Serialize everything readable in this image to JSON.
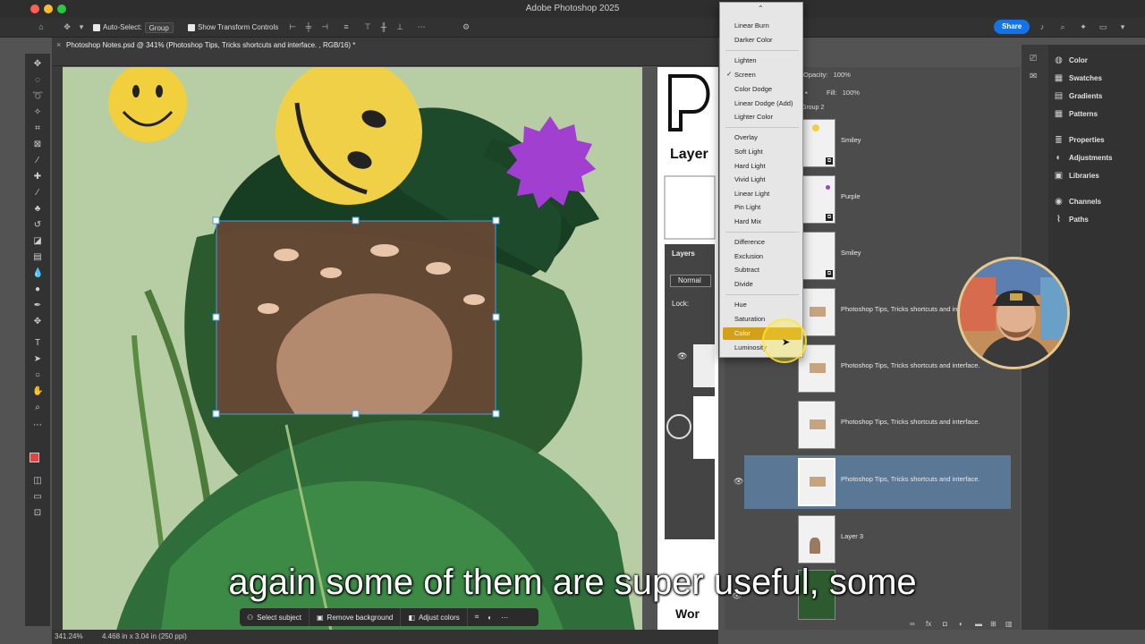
{
  "window": {
    "title": "Adobe Photoshop 2025"
  },
  "options_bar": {
    "auto_select_label": "Auto-Select:",
    "auto_select_value": "Group",
    "show_transform_label": "Show Transform Controls",
    "share_label": "Share"
  },
  "document": {
    "tab_title": "Photoshop Notes.psd @ 341% (Photoshop Tips, Tricks shortcuts and interface. , RGB/16) *",
    "zoom": "341.24%",
    "dimensions": "4.468 in x 3.04 in (250 ppi)"
  },
  "contextual_taskbar": {
    "select_subject": "Select subject",
    "remove_background": "Remove background",
    "adjust_colors": "Adjust colors"
  },
  "layers_panel": {
    "opacity_label": "Opacity:",
    "opacity_value": "100%",
    "fill_label": "Fill:",
    "fill_value": "100%",
    "group_label": "Group 2",
    "tab_label": "Layers",
    "blend_value": "Normal",
    "lock_label": "Lock:",
    "layers": [
      {
        "name": "Smiley"
      },
      {
        "name": "Purple"
      },
      {
        "name": "Smiley"
      },
      {
        "name": "Photoshop Tips,  Tricks shortcuts and interface."
      },
      {
        "name": "Photoshop Tips,  Tricks shortcuts and interface."
      },
      {
        "name": "Photoshop Tips,  Tricks shortcuts and interface."
      },
      {
        "name": "Photoshop Tips,  Tricks shortcuts and interface."
      },
      {
        "name": "Layer 3"
      }
    ]
  },
  "blend_menu": {
    "items": [
      "Linear Burn",
      "Darker Color",
      "Lighten",
      "Screen",
      "Color Dodge",
      "Linear Dodge (Add)",
      "Lighter Color",
      "Overlay",
      "Soft Light",
      "Hard Light",
      "Vivid Light",
      "Linear Light",
      "Pin Light",
      "Hard Mix",
      "Difference",
      "Exclusion",
      "Subtract",
      "Divide",
      "Hue",
      "Saturation",
      "Color",
      "Luminosity"
    ],
    "checked": "Screen",
    "highlighted": "Color"
  },
  "right_panel": {
    "items": [
      "Color",
      "Swatches",
      "Gradients",
      "Patterns",
      "Properties",
      "Adjustments",
      "Libraries",
      "Channels",
      "Paths"
    ]
  },
  "caption": "again some of them are super useful, some",
  "colors": {
    "foreground": "#e0463c",
    "background": "#4caf50",
    "accent_highlight": "#d4a019",
    "selected_layer": "#5b7796"
  }
}
